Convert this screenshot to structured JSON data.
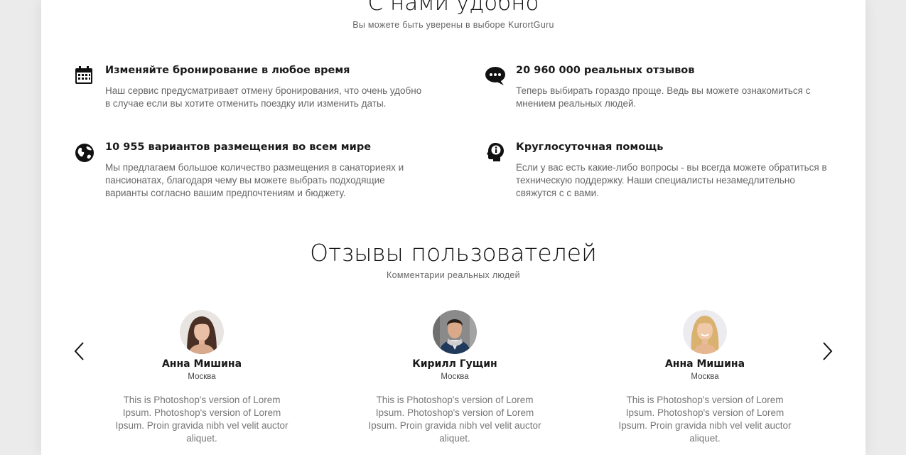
{
  "section_features": {
    "title": "С нами удобно",
    "subtitle": "Вы можете быть уверены в выборе KurortGuru"
  },
  "features": [
    {
      "icon": "calendar-icon",
      "title": "Изменяйте бронирование в любое время",
      "desc": "Наш сервис предусматривает отмену бронирования, что очень удобно в случае если вы хотите отменить поездку или изменить даты."
    },
    {
      "icon": "chat-bubble-icon",
      "title": "20 960 000 реальных отзывов",
      "desc": "Теперь выбирать гораздо проще. Ведь вы можете ознакомиться с мнением  реальных людей."
    },
    {
      "icon": "globe-icon",
      "title": "10 955 вариантов размещения во всем мире",
      "desc": "Мы предлагаем большое количество размещения в санаториеях и пансионатах, благодаря чему вы можете выбрать подходящие варианты согласно вашим предпочтениям и бюджету."
    },
    {
      "icon": "support-info-icon",
      "title": "Круглосуточная помощь",
      "desc": "Если у вас есть какие-либо вопросы - вы всегда можете обратиться в техническую поддержку. Наши специалисты незамедлительно свяжутся с с вами."
    }
  ],
  "section_reviews": {
    "title": "Отзывы пользователей",
    "subtitle": "Комментарии реальных людей"
  },
  "reviews": [
    {
      "name": "Анна Мишина",
      "city": "Москва",
      "text": "This is Photoshop's version  of Lorem Ipsum. Photoshop's version  of Lorem Ipsum. Proin gravida nibh vel velit auctor aliquet."
    },
    {
      "name": "Кирилл Гущин",
      "city": "Москва",
      "text": "This is Photoshop's version  of Lorem Ipsum. Photoshop's version  of Lorem Ipsum. Proin gravida nibh vel velit auctor aliquet."
    },
    {
      "name": "Анна Мишина",
      "city": "Москва",
      "text": "This is Photoshop's version  of Lorem Ipsum. Photoshop's version  of Lorem Ipsum. Proin gravida nibh vel velit auctor aliquet."
    }
  ],
  "carousel": {
    "prev_icon": "chevron-left-icon",
    "next_icon": "chevron-right-icon"
  }
}
